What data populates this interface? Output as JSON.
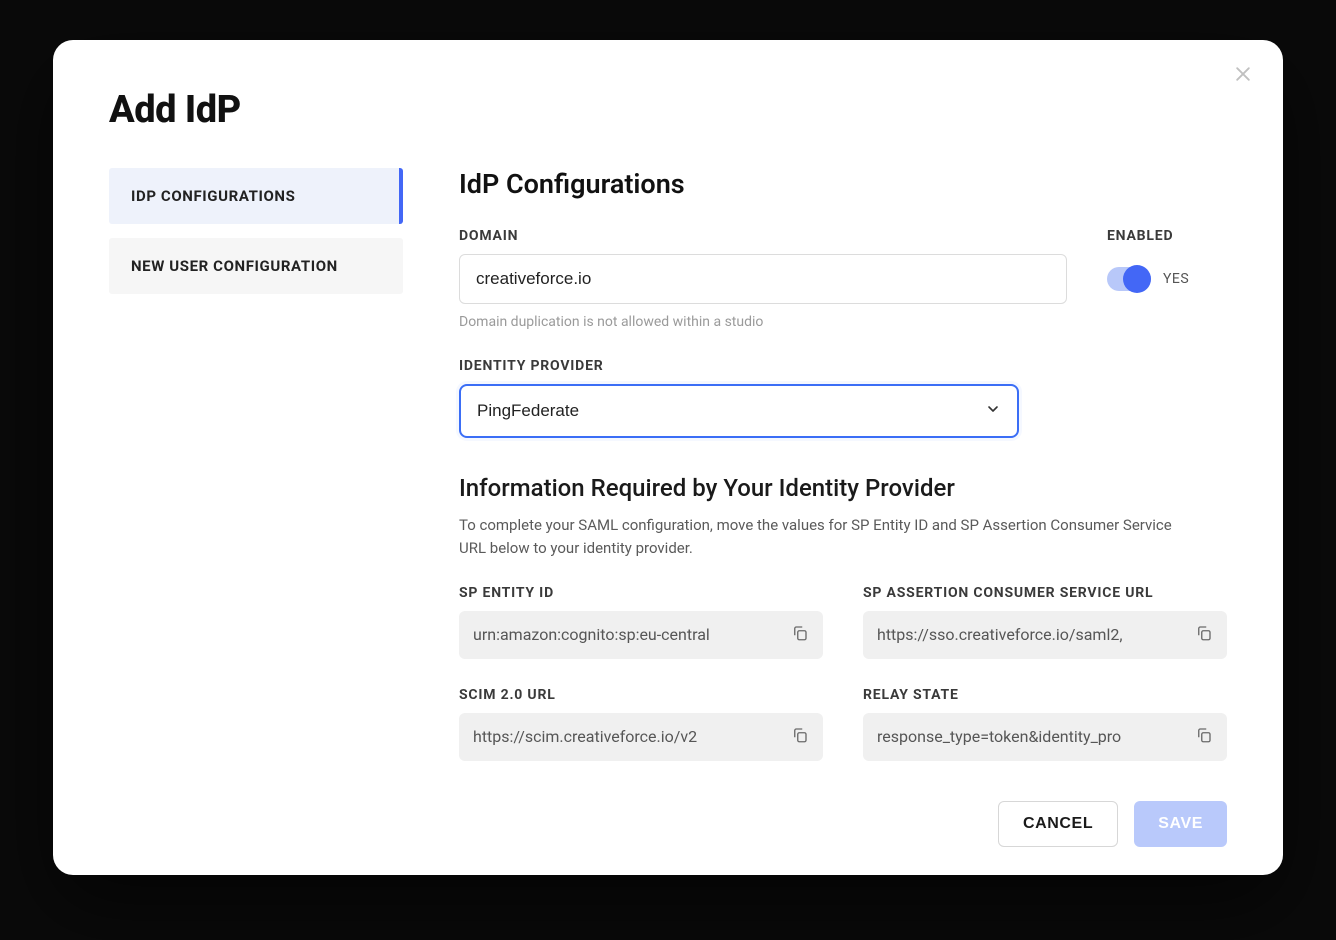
{
  "page_title": "Add IdP",
  "tabs": [
    {
      "label": "IDP CONFIGURATIONS",
      "active": true
    },
    {
      "label": "NEW USER CONFIGURATION",
      "active": false
    }
  ],
  "section": {
    "title": "IdP Configurations",
    "domain_label": "DOMAIN",
    "domain_value": "creativeforce.io",
    "domain_helper": "Domain duplication is not allowed within a studio",
    "enabled_label": "ENABLED",
    "enabled_text": "YES",
    "idp_label": "IDENTITY PROVIDER",
    "idp_value": "PingFederate"
  },
  "subsection": {
    "title": "Information Required by Your Identity Provider",
    "description": "To complete your SAML configuration, move the values for SP Entity ID and SP Assertion Consumer Service URL below to your identity provider."
  },
  "info_fields": [
    {
      "label": "SP ENTITY ID",
      "value": "urn:amazon:cognito:sp:eu-central"
    },
    {
      "label": "SP ASSERTION CONSUMER SERVICE URL",
      "value": "https://sso.creativeforce.io/saml2,"
    },
    {
      "label": "SCIM 2.0 URL",
      "value": "https://scim.creativeforce.io/v2"
    },
    {
      "label": "RELAY STATE",
      "value": "response_type=token&identity_pro"
    }
  ],
  "footer": {
    "cancel": "CANCEL",
    "save": "SAVE"
  }
}
